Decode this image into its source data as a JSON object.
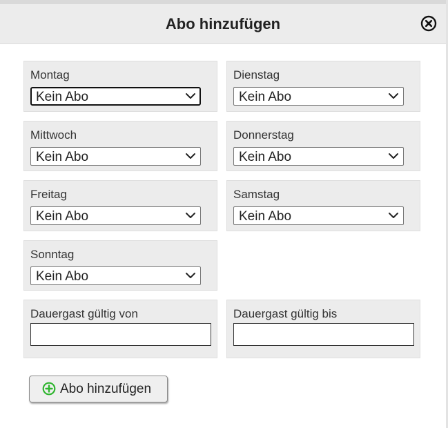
{
  "dialog": {
    "title": "Abo hinzufügen"
  },
  "days": [
    {
      "label": "Montag",
      "value": "Kein Abo"
    },
    {
      "label": "Dienstag",
      "value": "Kein Abo"
    },
    {
      "label": "Mittwoch",
      "value": "Kein Abo"
    },
    {
      "label": "Donnerstag",
      "value": "Kein Abo"
    },
    {
      "label": "Freitag",
      "value": "Kein Abo"
    },
    {
      "label": "Samstag",
      "value": "Kein Abo"
    },
    {
      "label": "Sonntag",
      "value": "Kein Abo"
    }
  ],
  "validity": {
    "from_label": "Dauergast gültig von",
    "from_value": "",
    "to_label": "Dauergast gültig bis",
    "to_value": ""
  },
  "actions": {
    "add_label": "Abo hinzufügen",
    "add_icon": "plus-circle-icon",
    "close_icon": "close-icon"
  },
  "colors": {
    "panel_bg": "#ececec",
    "add_icon_green": "#2fb52f"
  }
}
